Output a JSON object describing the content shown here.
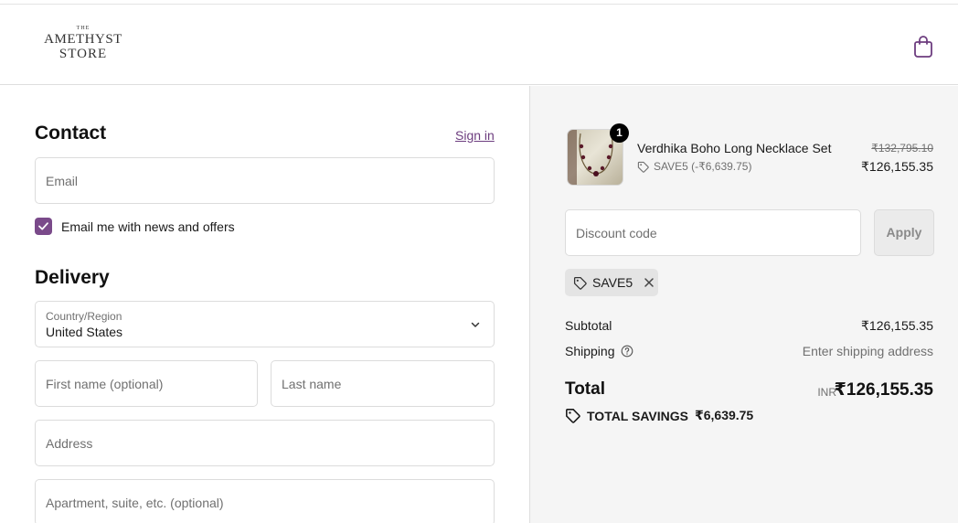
{
  "header": {
    "logo": {
      "top": "THE",
      "line1": "AMETHYST",
      "line2": "STORE"
    },
    "cart_icon": "shopping-bag-icon"
  },
  "contact": {
    "title": "Contact",
    "sign_in": "Sign in",
    "email_placeholder": "Email",
    "newsletter_label": "Email me with news and offers",
    "newsletter_checked": true
  },
  "delivery": {
    "title": "Delivery",
    "country_label": "Country/Region",
    "country_value": "United States",
    "first_name_placeholder": "First name (optional)",
    "last_name_placeholder": "Last name",
    "address_placeholder": "Address",
    "apartment_placeholder": "Apartment, suite, etc. (optional)"
  },
  "summary": {
    "product": {
      "quantity": "1",
      "name": "Verdhika Boho Long Necklace Set",
      "discount": "SAVE5 (-₹6,639.75)",
      "original_price": "₹132,795.10",
      "price": "₹126,155.35"
    },
    "discount_placeholder": "Discount code",
    "apply_label": "Apply",
    "applied_code": "SAVE5",
    "subtotal_label": "Subtotal",
    "subtotal_value": "₹126,155.35",
    "shipping_label": "Shipping",
    "shipping_value": "Enter shipping address",
    "total_label": "Total",
    "currency": "INR",
    "total_value": "₹126,155.35",
    "savings_label": "TOTAL SAVINGS",
    "savings_value": "₹6,639.75"
  },
  "colors": {
    "accent": "#7a4a8a",
    "link": "#6d3d7f",
    "summary_bg": "#f5f5f5"
  }
}
